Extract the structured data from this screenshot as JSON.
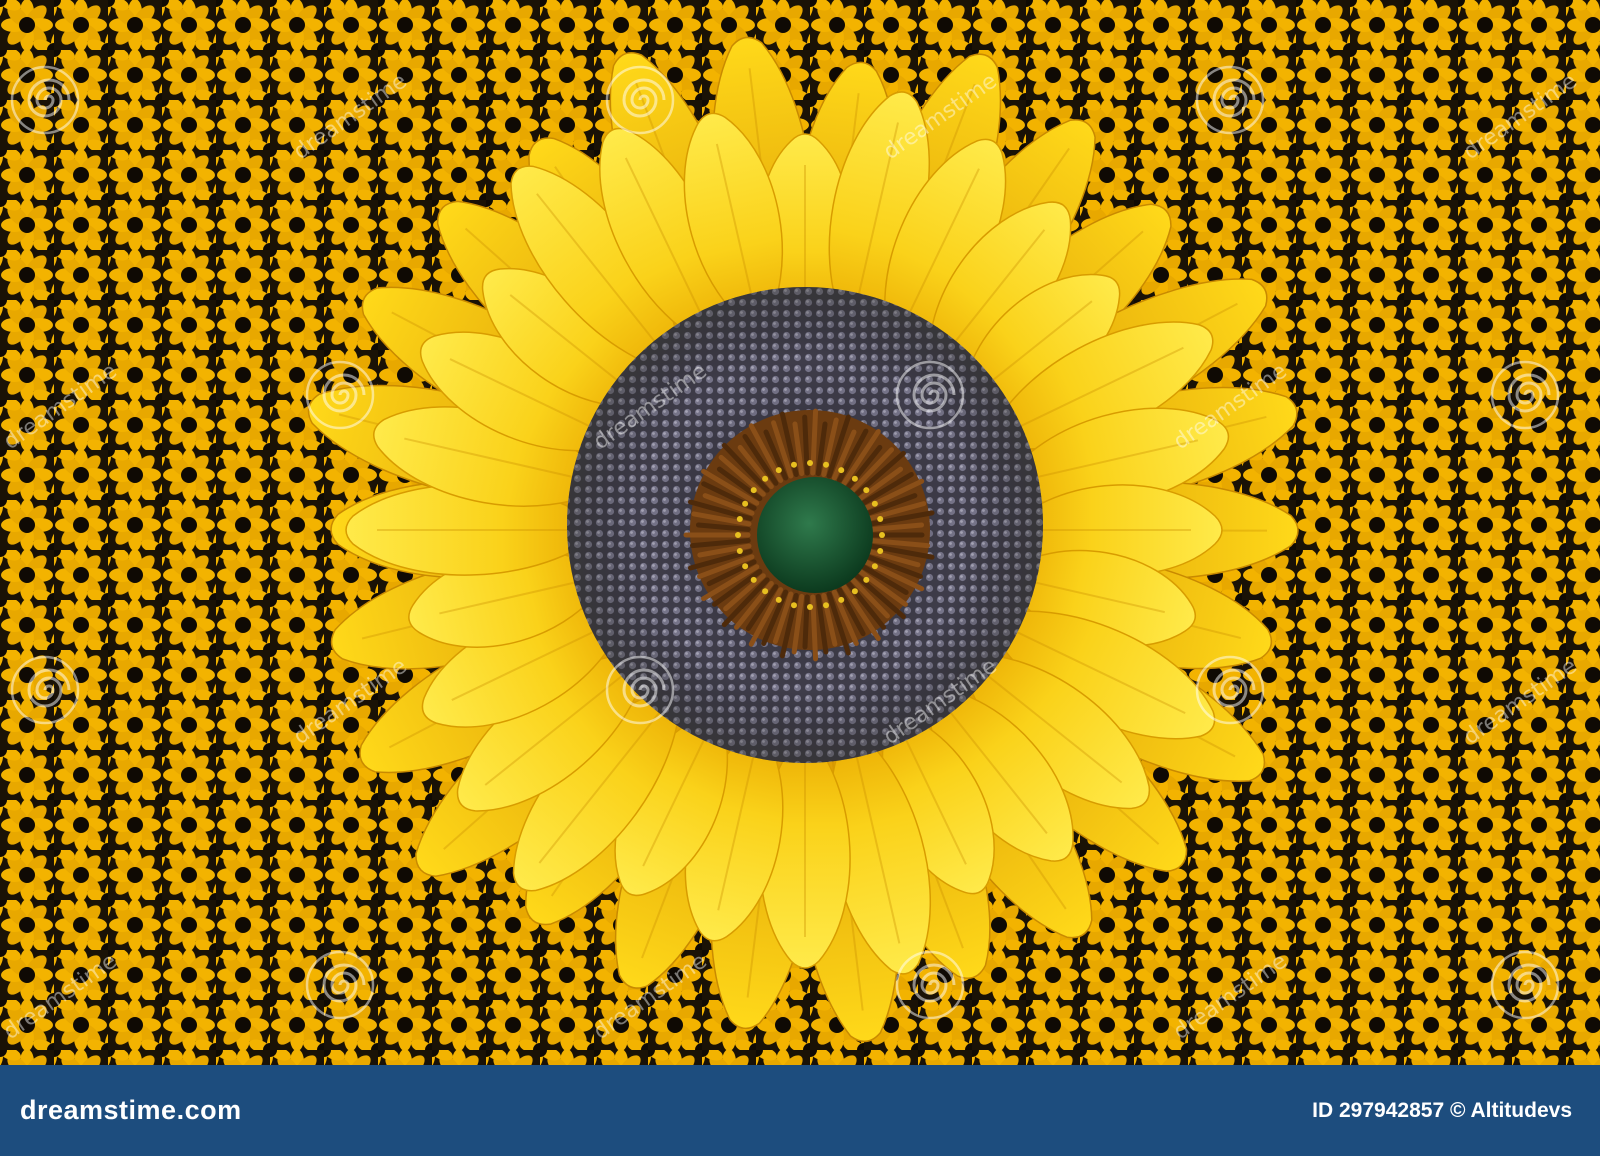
{
  "image": {
    "subject": "sunflower",
    "colors": {
      "petal_light": "#ffe236",
      "petal_mid": "#f7c400",
      "petal_dark": "#e0a000",
      "disc_grey": "#5d5b6a",
      "disc_brown": "#6b3b10",
      "center_green": "#1c5a34",
      "background_flower": "#f3b300",
      "background_dark": "#1a1206"
    }
  },
  "footer": {
    "brand": "dreamstime.com",
    "credit": "ID 297942857 © Altitudevs",
    "background": "#1d4d7e"
  },
  "watermark": {
    "text": "dreamstime",
    "color": "#ffffff"
  }
}
